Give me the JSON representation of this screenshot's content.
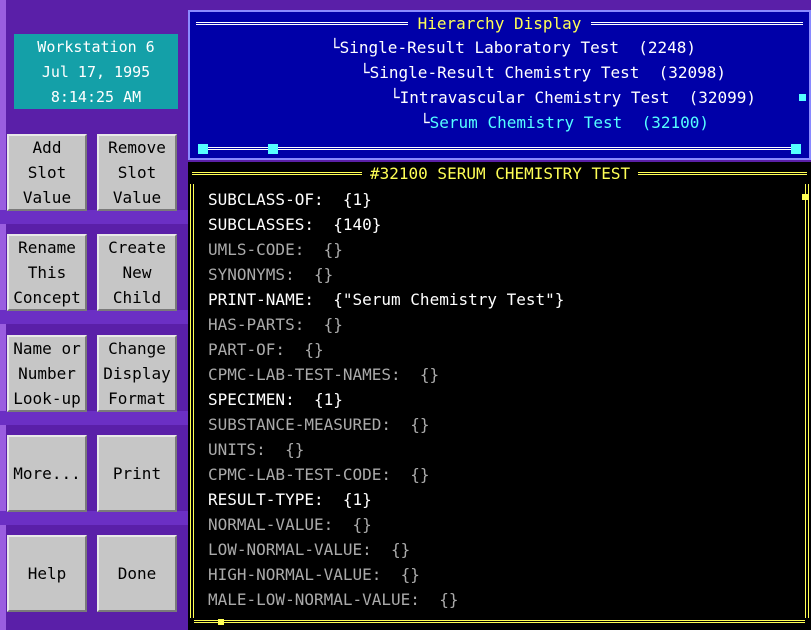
{
  "clock": {
    "line1": "Workstation 6",
    "line2": "Jul 17, 1995",
    "line3": "8:14:25 AM"
  },
  "buttons": {
    "add_slot_value": [
      "Add",
      "Slot",
      "Value"
    ],
    "remove_slot_value": [
      "Remove",
      "Slot",
      "Value"
    ],
    "rename_concept": [
      "Rename",
      "This",
      "Concept"
    ],
    "create_child": [
      "Create",
      "New",
      "Child"
    ],
    "name_lookup": [
      "Name or",
      "Number",
      "Look-up"
    ],
    "change_format": [
      "Change",
      "Display",
      "Format"
    ],
    "more": "More...",
    "print": "Print",
    "help": "Help",
    "done": "Done"
  },
  "hierarchy": {
    "title": "Hierarchy Display",
    "items": [
      {
        "label": "Single-Result Laboratory Test  (2248)",
        "selected": false
      },
      {
        "label": "Single-Result Chemistry Test  (32098)",
        "selected": false
      },
      {
        "label": "Intravascular Chemistry Test  (32099)",
        "selected": false
      },
      {
        "label": "Serum Chemistry Test  (32100)",
        "selected": true
      }
    ]
  },
  "detail": {
    "title": "#32100 SERUM CHEMISTRY TEST",
    "slots": [
      {
        "name": "SUBCLASS-OF:",
        "value": "{1}",
        "filled": true
      },
      {
        "name": "SUBCLASSES:",
        "value": "{140}",
        "filled": true
      },
      {
        "name": "UMLS-CODE:",
        "value": "{}",
        "filled": false
      },
      {
        "name": "SYNONYMS:",
        "value": "{}",
        "filled": false
      },
      {
        "name": "PRINT-NAME:",
        "value": "{\"Serum Chemistry Test\"}",
        "filled": true
      },
      {
        "name": "HAS-PARTS:",
        "value": "{}",
        "filled": false
      },
      {
        "name": "PART-OF:",
        "value": "{}",
        "filled": false
      },
      {
        "name": "CPMC-LAB-TEST-NAMES:",
        "value": "{}",
        "filled": false
      },
      {
        "name": "SPECIMEN:",
        "value": "{1}",
        "filled": true
      },
      {
        "name": "SUBSTANCE-MEASURED:",
        "value": "{}",
        "filled": false
      },
      {
        "name": "UNITS:",
        "value": "{}",
        "filled": false
      },
      {
        "name": "CPMC-LAB-TEST-CODE:",
        "value": "{}",
        "filled": false
      },
      {
        "name": "RESULT-TYPE:",
        "value": "{1}",
        "filled": true
      },
      {
        "name": "NORMAL-VALUE:",
        "value": "{}",
        "filled": false
      },
      {
        "name": "LOW-NORMAL-VALUE:",
        "value": "{}",
        "filled": false
      },
      {
        "name": "HIGH-NORMAL-VALUE:",
        "value": "{}",
        "filled": false
      },
      {
        "name": "MALE-LOW-NORMAL-VALUE:",
        "value": "{}",
        "filled": false
      }
    ]
  },
  "colors": {
    "left_panel": "#5a1fa8",
    "clock_bg": "#14a0a8",
    "button_bg": "#c6c6c6",
    "hierarchy_bg": "#0000a8",
    "selected_item": "#55ffff",
    "title_yellow": "#ffff55"
  }
}
